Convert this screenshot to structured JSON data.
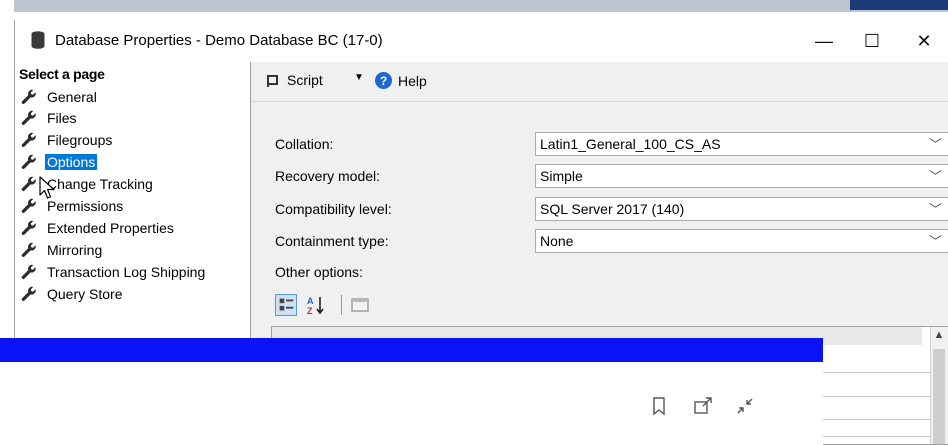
{
  "window": {
    "title": "Database Properties - Demo Database BC (17-0)",
    "controls": {
      "minimize": "—",
      "maximize": "☐",
      "close": "✕"
    }
  },
  "sidebar": {
    "header": "Select a page",
    "items": [
      {
        "label": "General",
        "selected": false
      },
      {
        "label": "Files",
        "selected": false
      },
      {
        "label": "Filegroups",
        "selected": false
      },
      {
        "label": "Options",
        "selected": true
      },
      {
        "label": "Change Tracking",
        "selected": false
      },
      {
        "label": "Permissions",
        "selected": false
      },
      {
        "label": "Extended Properties",
        "selected": false
      },
      {
        "label": "Mirroring",
        "selected": false
      },
      {
        "label": "Transaction Log Shipping",
        "selected": false
      },
      {
        "label": "Query Store",
        "selected": false
      }
    ]
  },
  "toolbar": {
    "script_label": "Script",
    "help_label": "Help"
  },
  "options": {
    "collation": {
      "label": "Collation:",
      "value": "Latin1_General_100_CS_AS"
    },
    "recovery_model": {
      "label": "Recovery model:",
      "value": "Simple"
    },
    "compatibility_level": {
      "label": "Compatibility level:",
      "value": "SQL Server 2017 (140)"
    },
    "containment_type": {
      "label": "Containment type:",
      "value": "None"
    },
    "other_options_label": "Other options:"
  },
  "overlay": {
    "band_color": "#0a13f5",
    "icons": [
      "bookmark-icon",
      "share-icon",
      "collapse-icon"
    ]
  },
  "colors": {
    "selection": "#0078d7",
    "help": "#1e66d0"
  }
}
